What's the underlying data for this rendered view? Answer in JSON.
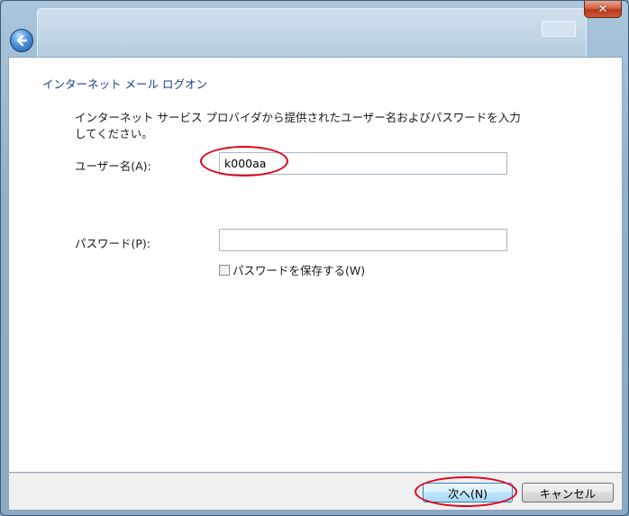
{
  "window": {
    "close_icon": "close-icon",
    "back_icon": "back-arrow-icon"
  },
  "page": {
    "heading": "インターネット メール ログオン",
    "description": "インターネット サービス プロバイダから提供されたユーザー名およびパスワードを入力してください。"
  },
  "form": {
    "username_label": "ユーザー名(A):",
    "username_value": "k000aa",
    "password_label": "パスワード(P):",
    "password_value": "",
    "save_password_label": "パスワードを保存する(W)",
    "save_password_checked": false
  },
  "buttons": {
    "next": "次へ(N)",
    "cancel": "キャンセル"
  },
  "colors": {
    "heading": "#1a3f8c",
    "annotation": "#e0001a"
  }
}
